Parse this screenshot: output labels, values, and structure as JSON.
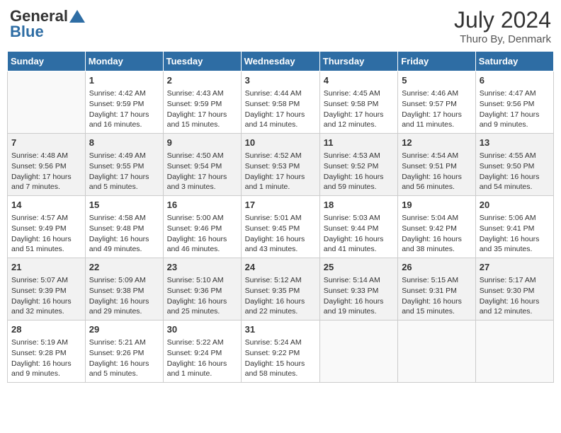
{
  "header": {
    "logo_line1": "General",
    "logo_line2": "Blue",
    "month_year": "July 2024",
    "location": "Thuro By, Denmark"
  },
  "weekdays": [
    "Sunday",
    "Monday",
    "Tuesday",
    "Wednesday",
    "Thursday",
    "Friday",
    "Saturday"
  ],
  "weeks": [
    [
      {
        "day": "",
        "sunrise": "",
        "sunset": "",
        "daylight": ""
      },
      {
        "day": "1",
        "sunrise": "Sunrise: 4:42 AM",
        "sunset": "Sunset: 9:59 PM",
        "daylight": "Daylight: 17 hours and 16 minutes."
      },
      {
        "day": "2",
        "sunrise": "Sunrise: 4:43 AM",
        "sunset": "Sunset: 9:59 PM",
        "daylight": "Daylight: 17 hours and 15 minutes."
      },
      {
        "day": "3",
        "sunrise": "Sunrise: 4:44 AM",
        "sunset": "Sunset: 9:58 PM",
        "daylight": "Daylight: 17 hours and 14 minutes."
      },
      {
        "day": "4",
        "sunrise": "Sunrise: 4:45 AM",
        "sunset": "Sunset: 9:58 PM",
        "daylight": "Daylight: 17 hours and 12 minutes."
      },
      {
        "day": "5",
        "sunrise": "Sunrise: 4:46 AM",
        "sunset": "Sunset: 9:57 PM",
        "daylight": "Daylight: 17 hours and 11 minutes."
      },
      {
        "day": "6",
        "sunrise": "Sunrise: 4:47 AM",
        "sunset": "Sunset: 9:56 PM",
        "daylight": "Daylight: 17 hours and 9 minutes."
      }
    ],
    [
      {
        "day": "7",
        "sunrise": "Sunrise: 4:48 AM",
        "sunset": "Sunset: 9:56 PM",
        "daylight": "Daylight: 17 hours and 7 minutes."
      },
      {
        "day": "8",
        "sunrise": "Sunrise: 4:49 AM",
        "sunset": "Sunset: 9:55 PM",
        "daylight": "Daylight: 17 hours and 5 minutes."
      },
      {
        "day": "9",
        "sunrise": "Sunrise: 4:50 AM",
        "sunset": "Sunset: 9:54 PM",
        "daylight": "Daylight: 17 hours and 3 minutes."
      },
      {
        "day": "10",
        "sunrise": "Sunrise: 4:52 AM",
        "sunset": "Sunset: 9:53 PM",
        "daylight": "Daylight: 17 hours and 1 minute."
      },
      {
        "day": "11",
        "sunrise": "Sunrise: 4:53 AM",
        "sunset": "Sunset: 9:52 PM",
        "daylight": "Daylight: 16 hours and 59 minutes."
      },
      {
        "day": "12",
        "sunrise": "Sunrise: 4:54 AM",
        "sunset": "Sunset: 9:51 PM",
        "daylight": "Daylight: 16 hours and 56 minutes."
      },
      {
        "day": "13",
        "sunrise": "Sunrise: 4:55 AM",
        "sunset": "Sunset: 9:50 PM",
        "daylight": "Daylight: 16 hours and 54 minutes."
      }
    ],
    [
      {
        "day": "14",
        "sunrise": "Sunrise: 4:57 AM",
        "sunset": "Sunset: 9:49 PM",
        "daylight": "Daylight: 16 hours and 51 minutes."
      },
      {
        "day": "15",
        "sunrise": "Sunrise: 4:58 AM",
        "sunset": "Sunset: 9:48 PM",
        "daylight": "Daylight: 16 hours and 49 minutes."
      },
      {
        "day": "16",
        "sunrise": "Sunrise: 5:00 AM",
        "sunset": "Sunset: 9:46 PM",
        "daylight": "Daylight: 16 hours and 46 minutes."
      },
      {
        "day": "17",
        "sunrise": "Sunrise: 5:01 AM",
        "sunset": "Sunset: 9:45 PM",
        "daylight": "Daylight: 16 hours and 43 minutes."
      },
      {
        "day": "18",
        "sunrise": "Sunrise: 5:03 AM",
        "sunset": "Sunset: 9:44 PM",
        "daylight": "Daylight: 16 hours and 41 minutes."
      },
      {
        "day": "19",
        "sunrise": "Sunrise: 5:04 AM",
        "sunset": "Sunset: 9:42 PM",
        "daylight": "Daylight: 16 hours and 38 minutes."
      },
      {
        "day": "20",
        "sunrise": "Sunrise: 5:06 AM",
        "sunset": "Sunset: 9:41 PM",
        "daylight": "Daylight: 16 hours and 35 minutes."
      }
    ],
    [
      {
        "day": "21",
        "sunrise": "Sunrise: 5:07 AM",
        "sunset": "Sunset: 9:39 PM",
        "daylight": "Daylight: 16 hours and 32 minutes."
      },
      {
        "day": "22",
        "sunrise": "Sunrise: 5:09 AM",
        "sunset": "Sunset: 9:38 PM",
        "daylight": "Daylight: 16 hours and 29 minutes."
      },
      {
        "day": "23",
        "sunrise": "Sunrise: 5:10 AM",
        "sunset": "Sunset: 9:36 PM",
        "daylight": "Daylight: 16 hours and 25 minutes."
      },
      {
        "day": "24",
        "sunrise": "Sunrise: 5:12 AM",
        "sunset": "Sunset: 9:35 PM",
        "daylight": "Daylight: 16 hours and 22 minutes."
      },
      {
        "day": "25",
        "sunrise": "Sunrise: 5:14 AM",
        "sunset": "Sunset: 9:33 PM",
        "daylight": "Daylight: 16 hours and 19 minutes."
      },
      {
        "day": "26",
        "sunrise": "Sunrise: 5:15 AM",
        "sunset": "Sunset: 9:31 PM",
        "daylight": "Daylight: 16 hours and 15 minutes."
      },
      {
        "day": "27",
        "sunrise": "Sunrise: 5:17 AM",
        "sunset": "Sunset: 9:30 PM",
        "daylight": "Daylight: 16 hours and 12 minutes."
      }
    ],
    [
      {
        "day": "28",
        "sunrise": "Sunrise: 5:19 AM",
        "sunset": "Sunset: 9:28 PM",
        "daylight": "Daylight: 16 hours and 9 minutes."
      },
      {
        "day": "29",
        "sunrise": "Sunrise: 5:21 AM",
        "sunset": "Sunset: 9:26 PM",
        "daylight": "Daylight: 16 hours and 5 minutes."
      },
      {
        "day": "30",
        "sunrise": "Sunrise: 5:22 AM",
        "sunset": "Sunset: 9:24 PM",
        "daylight": "Daylight: 16 hours and 1 minute."
      },
      {
        "day": "31",
        "sunrise": "Sunrise: 5:24 AM",
        "sunset": "Sunset: 9:22 PM",
        "daylight": "Daylight: 15 hours and 58 minutes."
      },
      {
        "day": "",
        "sunrise": "",
        "sunset": "",
        "daylight": ""
      },
      {
        "day": "",
        "sunrise": "",
        "sunset": "",
        "daylight": ""
      },
      {
        "day": "",
        "sunrise": "",
        "sunset": "",
        "daylight": ""
      }
    ]
  ]
}
